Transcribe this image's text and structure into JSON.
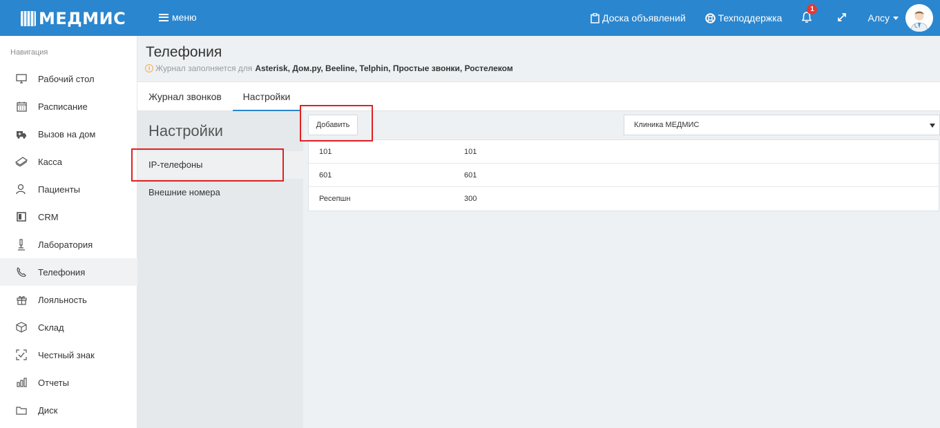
{
  "header": {
    "logo_text": "МЕДМИС",
    "menu_label": "меню",
    "board_label": "Доска объявлений",
    "support_label": "Техподдержка",
    "notification_count": "1",
    "user_name": "Алсу"
  },
  "sidebar": {
    "title": "Навигация",
    "items": [
      {
        "label": "Рабочий стол",
        "icon": "monitor-icon"
      },
      {
        "label": "Расписание",
        "icon": "calendar-icon"
      },
      {
        "label": "Вызов на дом",
        "icon": "ambulance-icon"
      },
      {
        "label": "Касса",
        "icon": "money-icon"
      },
      {
        "label": "Пациенты",
        "icon": "patients-icon"
      },
      {
        "label": "CRM",
        "icon": "board-icon"
      },
      {
        "label": "Лаборатория",
        "icon": "microscope-icon"
      },
      {
        "label": "Телефония",
        "icon": "phone-icon"
      },
      {
        "label": "Лояльность",
        "icon": "gift-icon"
      },
      {
        "label": "Склад",
        "icon": "box-icon"
      },
      {
        "label": "Честный знак",
        "icon": "scan-check-icon"
      },
      {
        "label": "Отчеты",
        "icon": "bar-chart-icon"
      },
      {
        "label": "Диск",
        "icon": "folder-icon"
      }
    ],
    "active_index": 7
  },
  "page": {
    "title": "Телефония",
    "subtitle_prefix": "Журнал заполняется для",
    "subtitle_providers": "Asterisk, Дом.ру, Beeline, Telphin, Простые звонки, Ростелеком"
  },
  "tabs": {
    "journal": "Журнал звонков",
    "settings": "Настройки"
  },
  "settings": {
    "title": "Настройки",
    "ip_phones": "IP-телефоны",
    "external_numbers": "Внешние номера"
  },
  "main": {
    "add_button": "Добавить",
    "clinic_select_value": "Клиника МЕДМИС",
    "rows": [
      {
        "name": "101",
        "number": "101"
      },
      {
        "name": "601",
        "number": "601"
      },
      {
        "name": "Ресепшн",
        "number": "300"
      }
    ]
  },
  "colors": {
    "brand": "#2a86cf",
    "highlight": "#e02020",
    "badge": "#e53935"
  }
}
